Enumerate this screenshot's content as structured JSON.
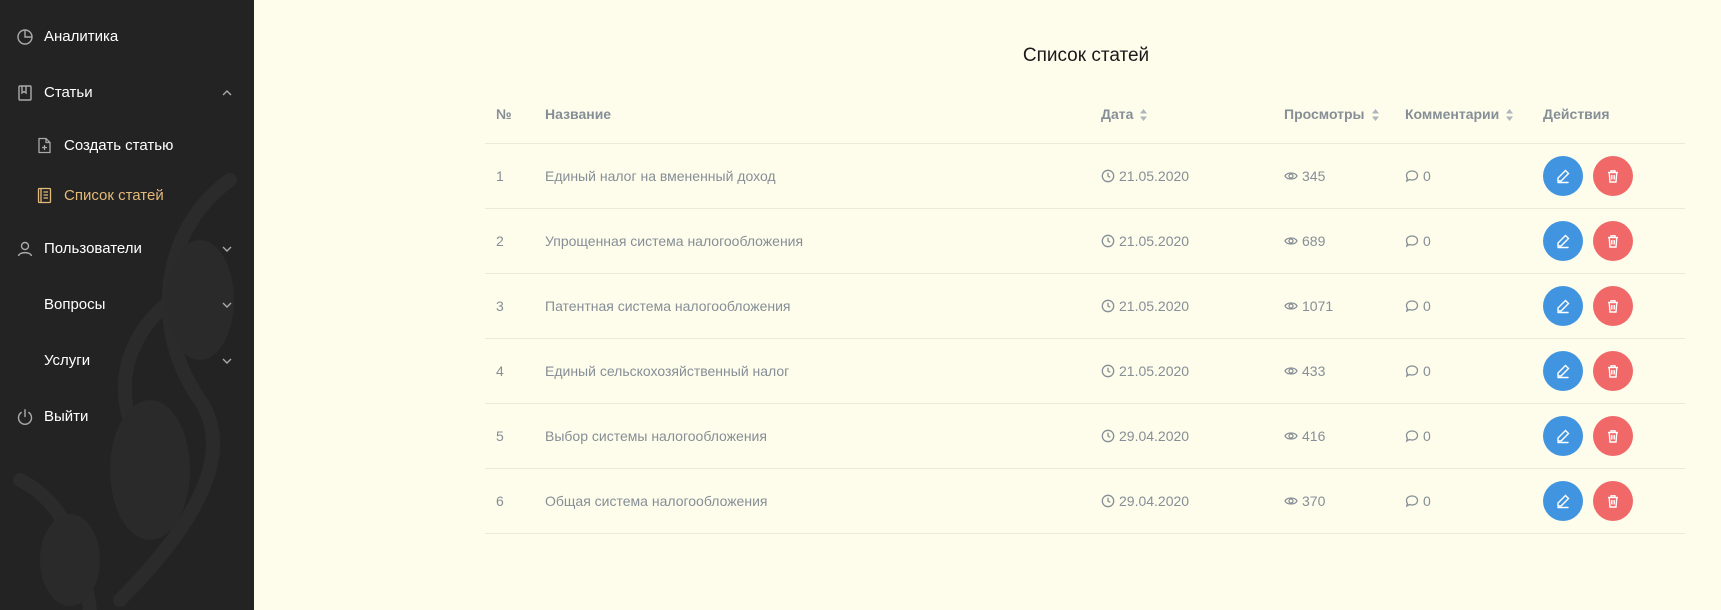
{
  "sidebar": {
    "items": [
      {
        "label": "Аналитика",
        "icon": "pie-chart-icon"
      },
      {
        "label": "Статьи",
        "icon": "book-icon",
        "expanded": true
      },
      {
        "label": "Пользователи",
        "icon": "user-icon"
      },
      {
        "label": "Вопросы"
      },
      {
        "label": "Услуги"
      },
      {
        "label": "Выйти",
        "icon": "power-icon"
      }
    ],
    "subitems": [
      {
        "label": "Создать статью",
        "icon": "file-plus-icon"
      },
      {
        "label": "Список статей",
        "icon": "list-document-icon",
        "active": true
      }
    ]
  },
  "main": {
    "title": "Список статей",
    "columns": [
      "№",
      "Название",
      "Дата",
      "Просмотры",
      "Комментарии",
      "Действия"
    ],
    "rows": [
      {
        "num": "1",
        "title": "Единый налог на вмененный доход",
        "date": "21.05.2020",
        "views": "345",
        "comments": "0"
      },
      {
        "num": "2",
        "title": "Упрощенная система налогообложения",
        "date": "21.05.2020",
        "views": "689",
        "comments": "0"
      },
      {
        "num": "3",
        "title": "Патентная система налогообложения",
        "date": "21.05.2020",
        "views": "1071",
        "comments": "0"
      },
      {
        "num": "4",
        "title": "Единый сельскохозяйственный налог",
        "date": "21.05.2020",
        "views": "433",
        "comments": "0"
      },
      {
        "num": "5",
        "title": "Выбор системы налогообложения",
        "date": "29.04.2020",
        "views": "416",
        "comments": "0"
      },
      {
        "num": "6",
        "title": "Общая система налогообложения",
        "date": "29.04.2020",
        "views": "370",
        "comments": "0"
      }
    ]
  },
  "colors": {
    "sidebar_bg": "#232323",
    "main_bg": "#fefdec",
    "active_text": "#e3ba79",
    "edit_button": "#4195e0",
    "delete_button": "#f06868",
    "muted_text": "#868e96"
  }
}
